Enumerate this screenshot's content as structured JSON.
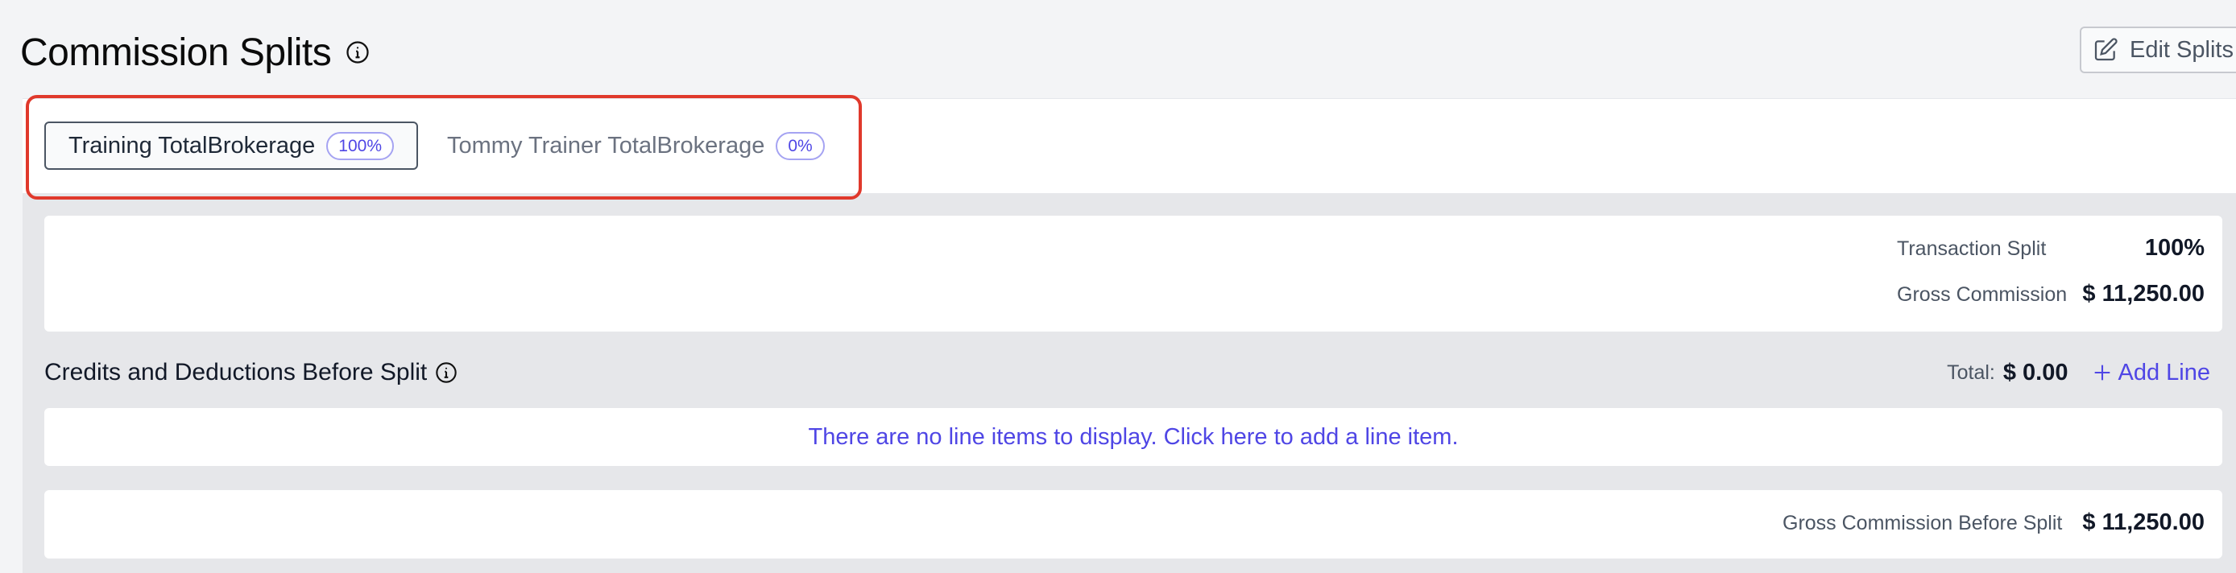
{
  "header": {
    "title": "Commission Splits",
    "edit_button_label": "Edit Splits"
  },
  "tabs": [
    {
      "label": "Training TotalBrokerage",
      "badge": "100%",
      "active": true
    },
    {
      "label": "Tommy Trainer TotalBrokerage",
      "badge": "0%",
      "active": false
    }
  ],
  "summary": {
    "transaction_split_label": "Transaction Split",
    "transaction_split_value": "100%",
    "gross_commission_label": "Gross Commission",
    "gross_commission_value": "$ 11,250.00"
  },
  "credits_section": {
    "title": "Credits and Deductions Before Split",
    "total_label": "Total:",
    "total_value": "$ 0.00",
    "add_line_label": "Add Line",
    "empty_message": "There are no line items to display. Click here to add a line item."
  },
  "footer": {
    "gross_before_split_label": "Gross Commission Before Split",
    "gross_before_split_value": "$ 11,250.00"
  },
  "colors": {
    "accent": "#4f46e5",
    "highlight_outline": "#e0392c",
    "panel_bg": "#e6e7ea"
  },
  "icons": {
    "title_info": "info-circle-icon",
    "edit": "edit-pencil-square-icon",
    "section_info": "info-circle-icon",
    "add": "plus-icon"
  }
}
